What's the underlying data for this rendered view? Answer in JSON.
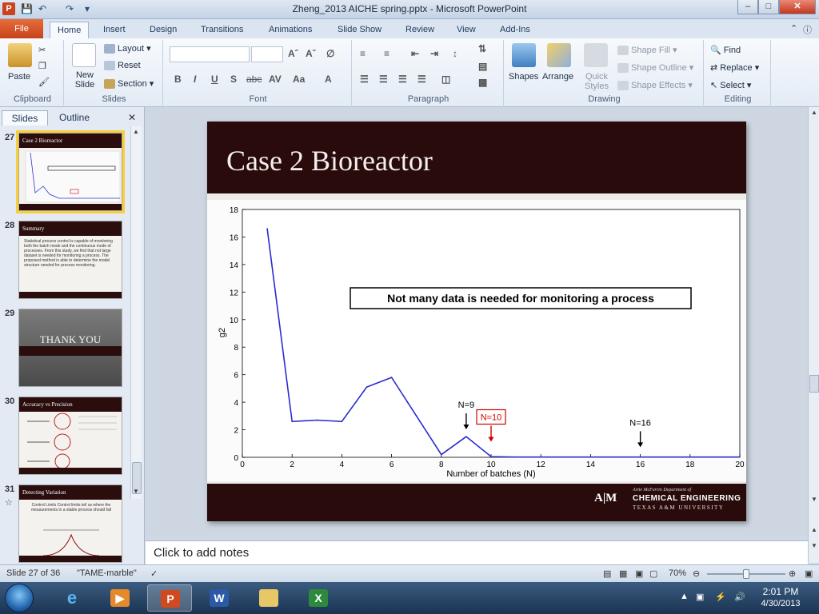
{
  "window": {
    "title": "Zheng_2013 AICHE spring.pptx - Microsoft PowerPoint",
    "app_icon": "P",
    "minimize": "–",
    "maximize": "□",
    "close": "✕"
  },
  "ribbon_tabs": [
    "File",
    "Home",
    "Insert",
    "Design",
    "Transitions",
    "Animations",
    "Slide Show",
    "Review",
    "View",
    "Add-Ins"
  ],
  "active_tab": "Home",
  "ribbon": {
    "clipboard": {
      "label": "Clipboard",
      "paste": "Paste"
    },
    "slides": {
      "label": "Slides",
      "new_slide": "New Slide",
      "layout": "Layout",
      "reset": "Reset",
      "section": "Section"
    },
    "font": {
      "label": "Font",
      "buttons": [
        "B",
        "I",
        "U",
        "S",
        "abc",
        "AV",
        "Aa",
        "A"
      ]
    },
    "paragraph": {
      "label": "Paragraph"
    },
    "drawing": {
      "label": "Drawing",
      "shapes": "Shapes",
      "arrange": "Arrange",
      "quick_styles": "Quick Styles",
      "shape_fill": "Shape Fill",
      "shape_outline": "Shape Outline",
      "shape_effects": "Shape Effects"
    },
    "editing": {
      "label": "Editing",
      "find": "Find",
      "replace": "Replace",
      "select": "Select"
    }
  },
  "left_panel": {
    "tabs": [
      "Slides",
      "Outline"
    ],
    "close": "✕",
    "thumbnails": [
      {
        "num": "27",
        "title": "Case 2 Bioreactor",
        "selected": true
      },
      {
        "num": "28",
        "title": "Summary",
        "body": "Statistical process control is capable of monitoring both the batch mode and the continuous mode of processes. From this study, we find that not large dataset is needed for monitoring a process. The proposed method is able to determine the model structure needed for process monitoring."
      },
      {
        "num": "29",
        "title": "THANK YOU"
      },
      {
        "num": "30",
        "title": "Accuracy vs Precision"
      },
      {
        "num": "31",
        "title": "Detecting Variation",
        "body": "Control Limits\nControl limits tell us where the measurements in a stable process should fall"
      }
    ]
  },
  "slide": {
    "title": "Case 2 Bioreactor",
    "footer_logo": "A|M",
    "footer_dept": "Artie McFerrin Department of",
    "footer_ce": "CHEMICAL ENGINEERING",
    "footer_univ": "TEXAS A&M UNIVERSITY"
  },
  "chart_data": {
    "type": "line",
    "xlabel": "Number of batches (N)",
    "ylabel": "g2",
    "xlim": [
      0,
      20
    ],
    "ylim": [
      0,
      18
    ],
    "xticks": [
      0,
      2,
      4,
      6,
      8,
      10,
      12,
      14,
      16,
      18,
      20
    ],
    "yticks": [
      0,
      2,
      4,
      6,
      8,
      10,
      12,
      14,
      16,
      18
    ],
    "series": [
      {
        "color": "#2b2bd0",
        "x": [
          1,
          2,
          3,
          4,
          5,
          6,
          7,
          8,
          9,
          10,
          11,
          12,
          13,
          14,
          15,
          16,
          17,
          18,
          19,
          20
        ],
        "y": [
          16.6,
          2.6,
          2.7,
          2.6,
          5.1,
          5.8,
          3.0,
          0.2,
          1.5,
          0.05,
          0.02,
          0.02,
          0.02,
          0.02,
          0.02,
          0.02,
          0.02,
          0.02,
          0.02,
          0.02
        ]
      }
    ],
    "callout": "Not many data is needed for monitoring a process",
    "annotations": [
      {
        "text": "N=9",
        "x": 9,
        "y": 1.8,
        "color": "#000000",
        "boxed": false
      },
      {
        "text": "N=10",
        "x": 10,
        "y": 0.9,
        "color": "#cc0000",
        "boxed": true
      },
      {
        "text": "N=16",
        "x": 16,
        "y": 0.5,
        "color": "#000000",
        "boxed": false
      }
    ]
  },
  "notes": {
    "placeholder": "Click to add notes"
  },
  "status": {
    "slide_info": "Slide 27 of 36",
    "theme": "\"TAME-marble\"",
    "zoom": "70%",
    "zoom_fraction": 0.5
  },
  "taskbar": {
    "apps": [
      "Internet Explorer",
      "Media Player",
      "PowerPoint",
      "Word",
      "Windows Explorer",
      "Excel"
    ],
    "time": "2:01 PM",
    "date": "4/30/2013"
  }
}
